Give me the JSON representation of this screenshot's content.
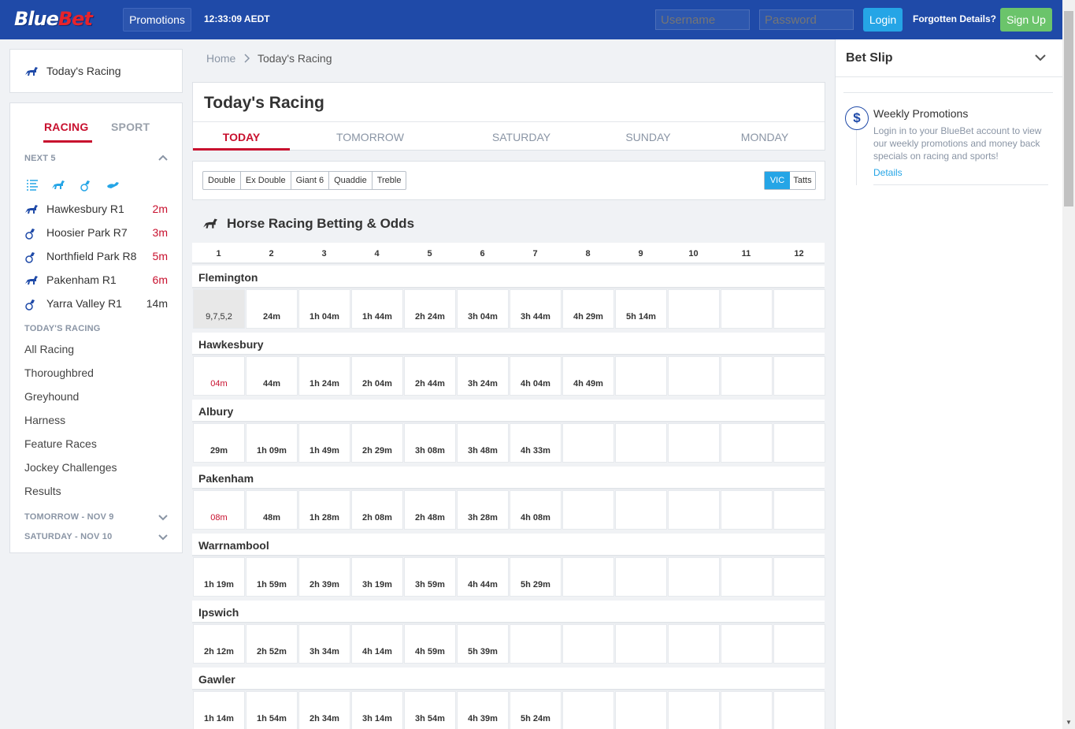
{
  "header": {
    "logo_blue": "Blue",
    "logo_red": "Bet",
    "promotions_label": "Promotions",
    "clock": "12:33:09 AEDT",
    "username_placeholder": "Username",
    "password_placeholder": "Password",
    "login_label": "Login",
    "forgot_label": "Forgotten Details?",
    "signup_label": "Sign Up"
  },
  "sidebar": {
    "today_link": "Today's Racing",
    "tabs": [
      "RACING",
      "SPORT"
    ],
    "next5_title": "NEXT 5",
    "next5": [
      {
        "name": "Hawkesbury R1",
        "time": "2m",
        "icon": "horse-icon",
        "red": true
      },
      {
        "name": "Hoosier Park R7",
        "time": "3m",
        "icon": "harness-icon",
        "red": true
      },
      {
        "name": "Northfield Park R8",
        "time": "5m",
        "icon": "harness-icon",
        "red": true
      },
      {
        "name": "Pakenham R1",
        "time": "6m",
        "icon": "horse-icon",
        "red": true
      },
      {
        "name": "Yarra Valley R1",
        "time": "14m",
        "icon": "harness-icon",
        "red": false
      }
    ],
    "todays_racing_title": "TODAY'S RACING",
    "links": [
      "All Racing",
      "Thoroughbred",
      "Greyhound",
      "Harness",
      "Feature Races",
      "Jockey Challenges",
      "Results"
    ],
    "tomorrow_title": "TOMORROW - NOV 9",
    "saturday_title": "SATURDAY - NOV 10"
  },
  "breadcrumb": {
    "home": "Home",
    "current": "Today's Racing"
  },
  "main": {
    "title": "Today's Racing",
    "day_tabs": [
      "TODAY",
      "TOMORROW",
      "SATURDAY",
      "SUNDAY",
      "MONDAY"
    ],
    "bet_types": [
      "Double",
      "Ex Double",
      "Giant 6",
      "Quaddie",
      "Treble"
    ],
    "tote_options": [
      "VIC",
      "Tatts"
    ],
    "section_title": "Horse Racing Betting & Odds",
    "race_numbers": [
      "1",
      "2",
      "3",
      "4",
      "5",
      "6",
      "7",
      "8",
      "9",
      "10",
      "11",
      "12"
    ],
    "meetings": [
      {
        "name": "Flemington",
        "races": [
          "9,7,5,2",
          "24m",
          "1h 04m",
          "1h 44m",
          "2h 24m",
          "3h 04m",
          "3h 44m",
          "4h 29m",
          "5h 14m",
          "",
          "",
          ""
        ],
        "first_state": "done"
      },
      {
        "name": "Hawkesbury",
        "races": [
          "04m",
          "44m",
          "1h 24m",
          "2h 04m",
          "2h 44m",
          "3h 24m",
          "4h 04m",
          "4h 49m",
          "",
          "",
          "",
          ""
        ],
        "first_state": "red"
      },
      {
        "name": "Albury",
        "races": [
          "29m",
          "1h 09m",
          "1h 49m",
          "2h 29m",
          "3h 08m",
          "3h 48m",
          "4h 33m",
          "",
          "",
          "",
          "",
          ""
        ],
        "first_state": ""
      },
      {
        "name": "Pakenham",
        "races": [
          "08m",
          "48m",
          "1h 28m",
          "2h 08m",
          "2h 48m",
          "3h 28m",
          "4h 08m",
          "",
          "",
          "",
          "",
          ""
        ],
        "first_state": "red"
      },
      {
        "name": "Warrnambool",
        "races": [
          "1h 19m",
          "1h 59m",
          "2h 39m",
          "3h 19m",
          "3h 59m",
          "4h 44m",
          "5h 29m",
          "",
          "",
          "",
          "",
          ""
        ],
        "first_state": ""
      },
      {
        "name": "Ipswich",
        "races": [
          "2h 12m",
          "2h 52m",
          "3h 34m",
          "4h 14m",
          "4h 59m",
          "5h 39m",
          "",
          "",
          "",
          "",
          "",
          ""
        ],
        "first_state": ""
      },
      {
        "name": "Gawler",
        "races": [
          "1h 14m",
          "1h 54m",
          "2h 34m",
          "3h 14m",
          "3h 54m",
          "4h 39m",
          "5h 24m",
          "",
          "",
          "",
          "",
          ""
        ],
        "first_state": ""
      }
    ]
  },
  "betslip": {
    "title": "Bet Slip",
    "promo_title": "Weekly Promotions",
    "promo_text": "Login in to your BlueBet account to view our weekly promotions and money back specials on racing and sports!",
    "promo_link": "Details",
    "promo_icon": "$"
  },
  "colors": {
    "brand_blue": "#1f4aa8",
    "accent_red": "#c8102e",
    "login_blue": "#25a5e6",
    "signup_green": "#6bc46b"
  }
}
